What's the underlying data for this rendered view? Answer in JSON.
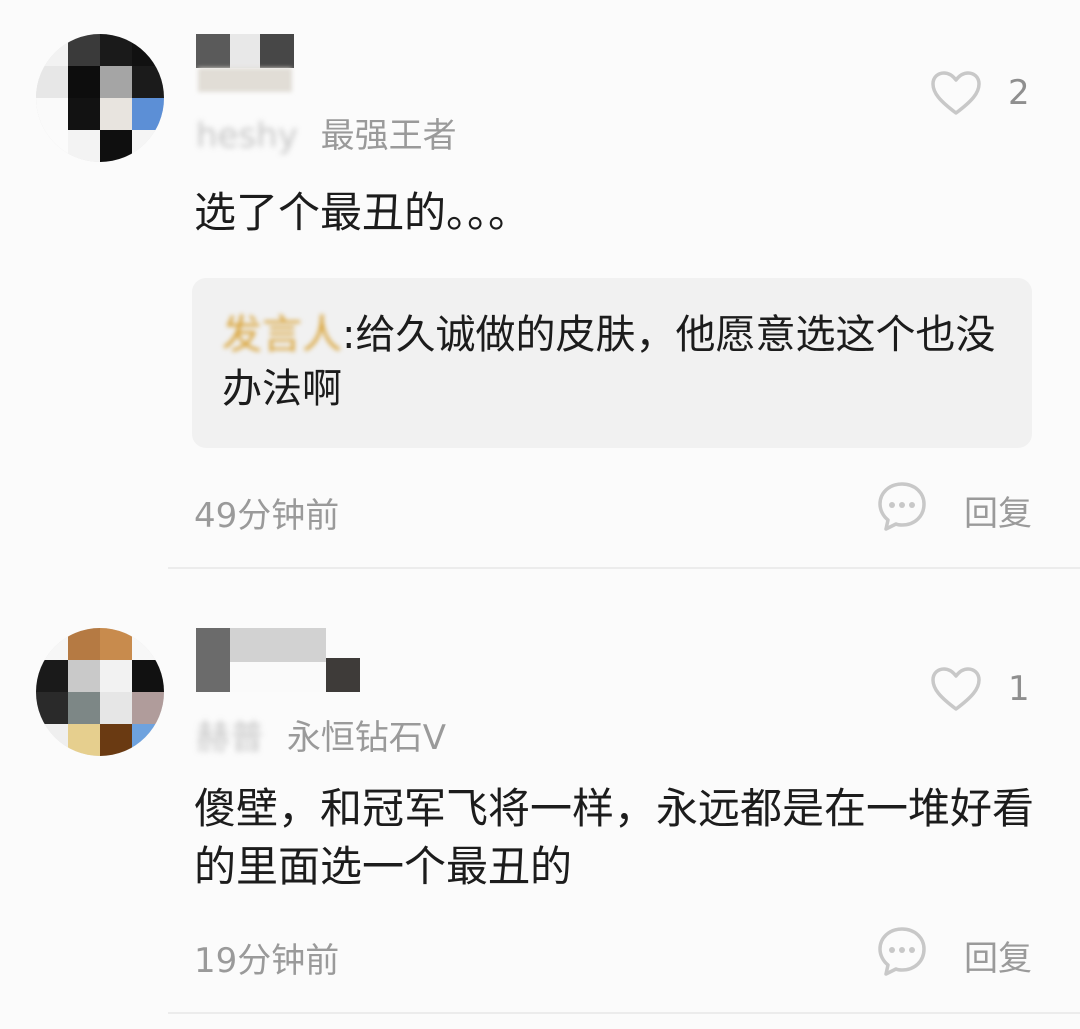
{
  "comments": [
    {
      "handle_partial": "heshy",
      "badge": "最强王者",
      "like_count": "2",
      "text": "选了个最丑的。。。",
      "quote": {
        "author": "发言人",
        "text": ":给久诚做的皮肤，他愿意选这个也没办法啊"
      },
      "time": "49分钟前",
      "reply_label": "回复"
    },
    {
      "handle_partial": "赫普",
      "badge": "永恒钻石V",
      "like_count": "1",
      "text": "傻壁，和冠军飞将一样，永远都是在一堆好看的里面选一个最丑的",
      "time": "19分钟前",
      "reply_label": "回复"
    }
  ],
  "colors": {
    "background": "#fbfbfb",
    "quote_bg": "#f1f1f1",
    "muted_text": "#9a9a9a",
    "quote_author": "#d9a43a",
    "icon_stroke": "#c8c8c8"
  },
  "icons": {
    "like": "heart-outline-icon",
    "reply": "chat-bubble-dots-icon"
  }
}
